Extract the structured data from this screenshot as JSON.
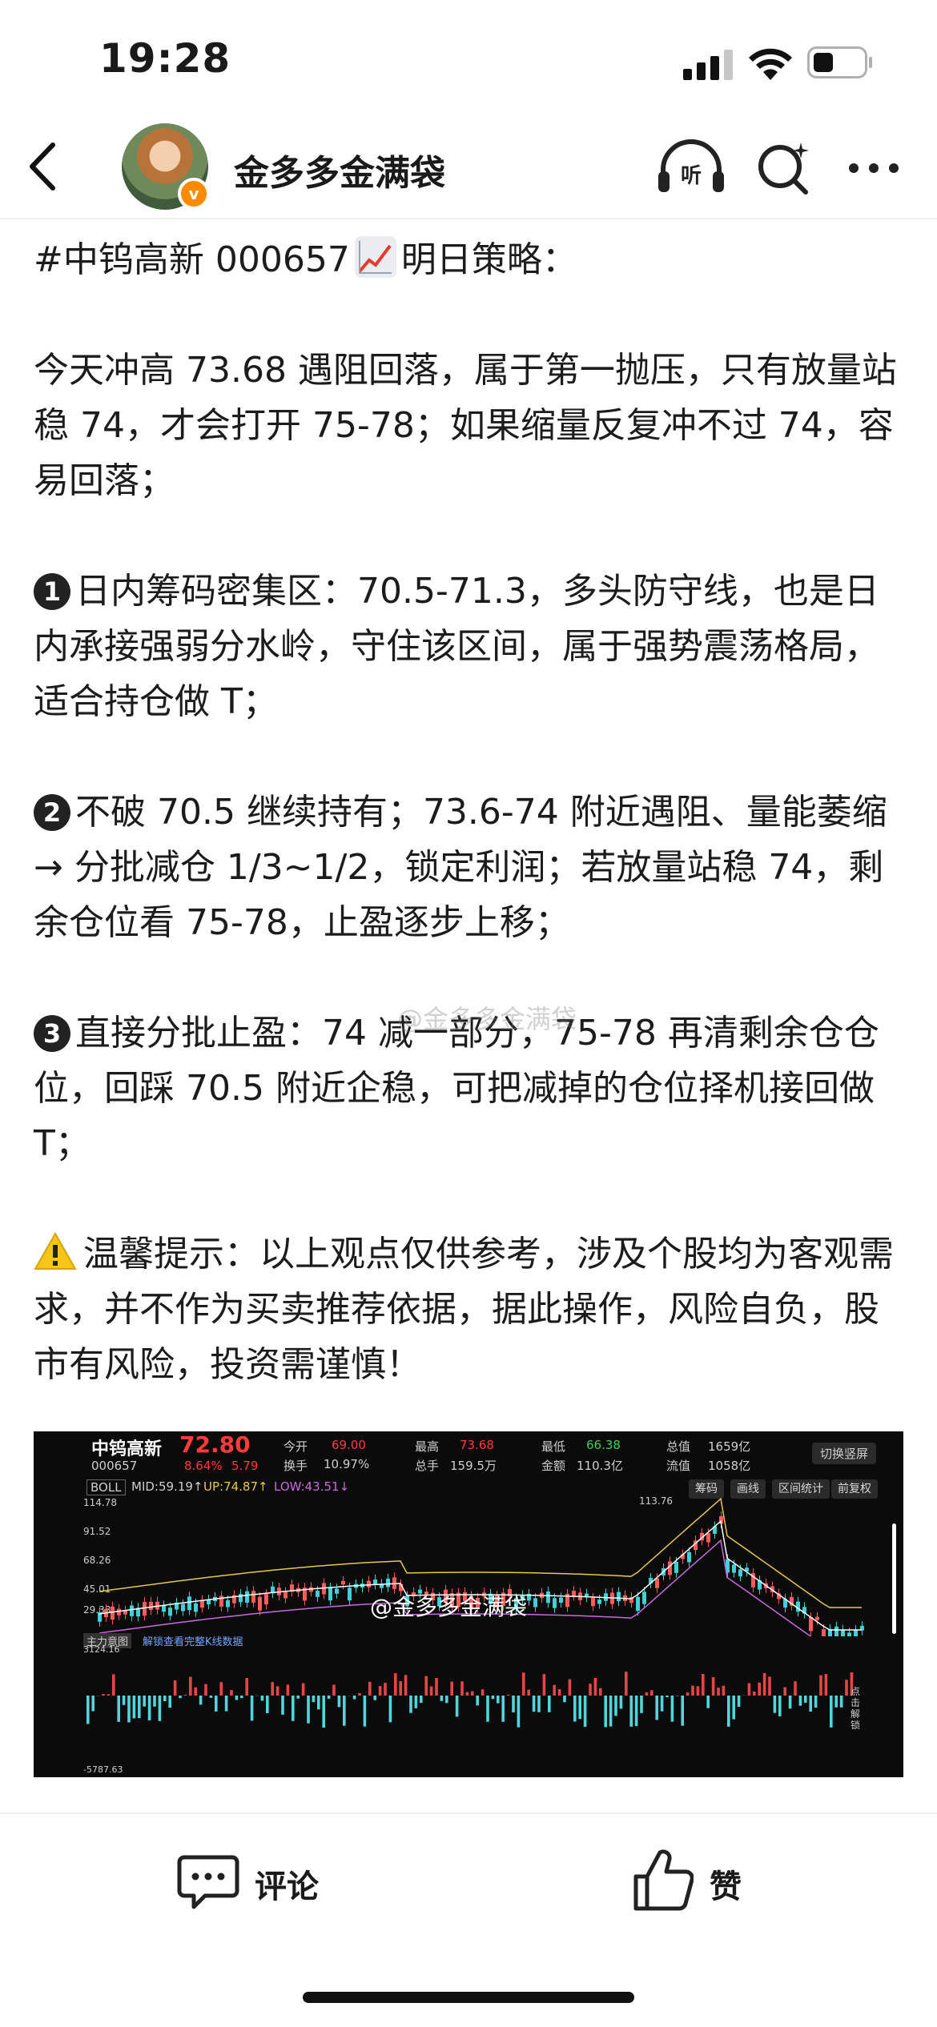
{
  "status_bar": {
    "time": "19:28"
  },
  "header": {
    "account_name": "金多多金满袋",
    "verified_badge": "v"
  },
  "post": {
    "title_prefix": "#中钨高新 000657",
    "title_suffix": "明日策略：",
    "p1": "今天冲高 73.68 遇阻回落，属于第一抛压，只有放量站稳 74，才会打开 75-78；如果缩量反复冲不过 74，容易回落；",
    "p2_num": "1",
    "p2": "日内筹码密集区：70.5-71.3，多头防守线，也是日内承接强弱分水岭，守住该区间，属于强势震荡格局，适合持仓做 T；",
    "p3_num": "2",
    "p3": "不破 70.5 继续持有；73.6-74 附近遇阻、量能萎缩 → 分批减仓 1/3~1/2，锁定利润；若放量站稳 74，剩余仓位看 75-78，止盈逐步上移；",
    "p4_num": "3",
    "p4": "直接分批止盈：74 减一部分，75-78 再清剩余仓仓位，回踩 70.5 附近企稳，可把减掉的仓位择机接回做 T；",
    "p5": "温馨提示：以上观点仅供参考，涉及个股均为客观需求，并不作为买卖推荐依据，据此操作，风险自负，股市有风险，投资需谨慎！"
  },
  "watermark": "@金多多金满袋",
  "stock_image": {
    "name": "中钨高新",
    "code": "000657",
    "price": "72.80",
    "change_pct": "8.64%",
    "change_abs": "5.79",
    "fields": [
      {
        "label": "今开",
        "value": "69.00"
      },
      {
        "label": "换手",
        "value": "10.97%"
      },
      {
        "label": "最高",
        "value": "73.68"
      },
      {
        "label": "总手",
        "value": "159.5万"
      },
      {
        "label": "最低",
        "value": "66.38"
      },
      {
        "label": "金额",
        "value": "110.3亿"
      },
      {
        "label": "总值",
        "value": "1659亿"
      },
      {
        "label": "流值",
        "value": "1058亿"
      }
    ],
    "switch_btn": "切换竖屏",
    "indicator": "BOLL",
    "mid": "MID:59.19↑",
    "up": "UP:74.87↑",
    "low": "LOW:43.51↓",
    "tabs": [
      "筹码",
      "画线",
      "区间统计",
      "前复权"
    ],
    "y_ticks": [
      "114.78",
      "91.52",
      "68.26",
      "45.01",
      "29.38"
    ],
    "high_label": "113.76",
    "sub_title": "主力意图",
    "sub_hint": "解锁查看完整K线数据",
    "sub_max": "3124.16",
    "sub_min": "-5787.63",
    "side_label": "点击解锁",
    "watermark": "@金多多金满袋"
  },
  "bottom_bar": {
    "comment": "评论",
    "like": "赞"
  }
}
